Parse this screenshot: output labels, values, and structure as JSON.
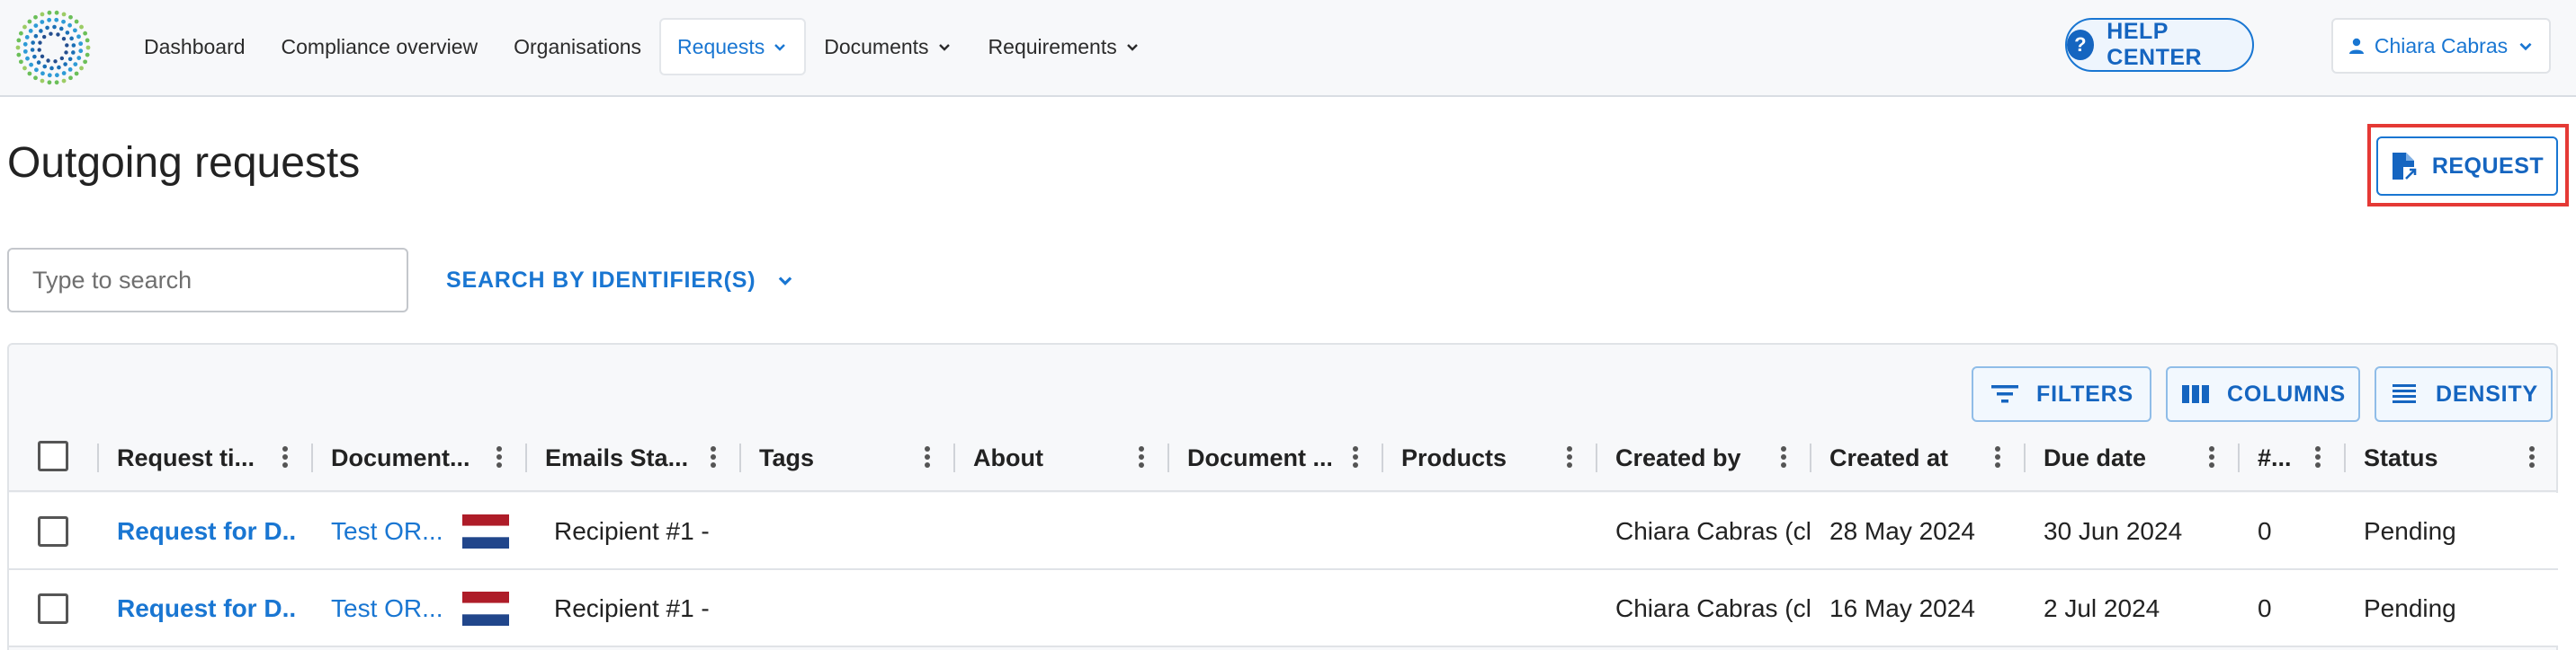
{
  "nav": {
    "items": [
      {
        "label": "Dashboard"
      },
      {
        "label": "Compliance overview"
      },
      {
        "label": "Organisations"
      },
      {
        "label": "Requests"
      },
      {
        "label": "Documents"
      },
      {
        "label": "Requirements"
      }
    ],
    "help_label": "HELP CENTER",
    "user_name": "Chiara Cabras"
  },
  "page": {
    "title": "Outgoing requests",
    "request_button": "REQUEST"
  },
  "search": {
    "placeholder": "Type to search",
    "identifier_label": "SEARCH BY IDENTIFIER(S)"
  },
  "toolbar": {
    "filters": "FILTERS",
    "columns": "COLUMNS",
    "density": "DENSITY"
  },
  "table": {
    "columns": [
      "Request ti...",
      "Document...",
      "Emails Sta...",
      "Tags",
      "About",
      "Document ...",
      "Products",
      "Created by",
      "Created at",
      "Due date",
      "#...",
      "Status"
    ],
    "rows": [
      {
        "request_title": "Request for D...",
        "document": "Test OR...",
        "flag": "netherlands-flag",
        "emails_status": "Recipient #1 -",
        "created_by": "Chiara Cabras (ch",
        "created_at": "28 May 2024",
        "due_date": "30 Jun 2024",
        "count": "0",
        "status": "Pending"
      },
      {
        "request_title": "Request for D...",
        "document": "Test OR...",
        "flag": "netherlands-flag",
        "emails_status": "Recipient #1 -",
        "created_by": "Chiara Cabras (ch",
        "created_at": "16 May 2024",
        "due_date": "2 Jul 2024",
        "count": "0",
        "status": "Pending"
      }
    ]
  },
  "colors": {
    "accent": "#1976d2",
    "highlight": "#e53935",
    "flag_red": "#ae1c28",
    "flag_blue": "#21468b"
  }
}
